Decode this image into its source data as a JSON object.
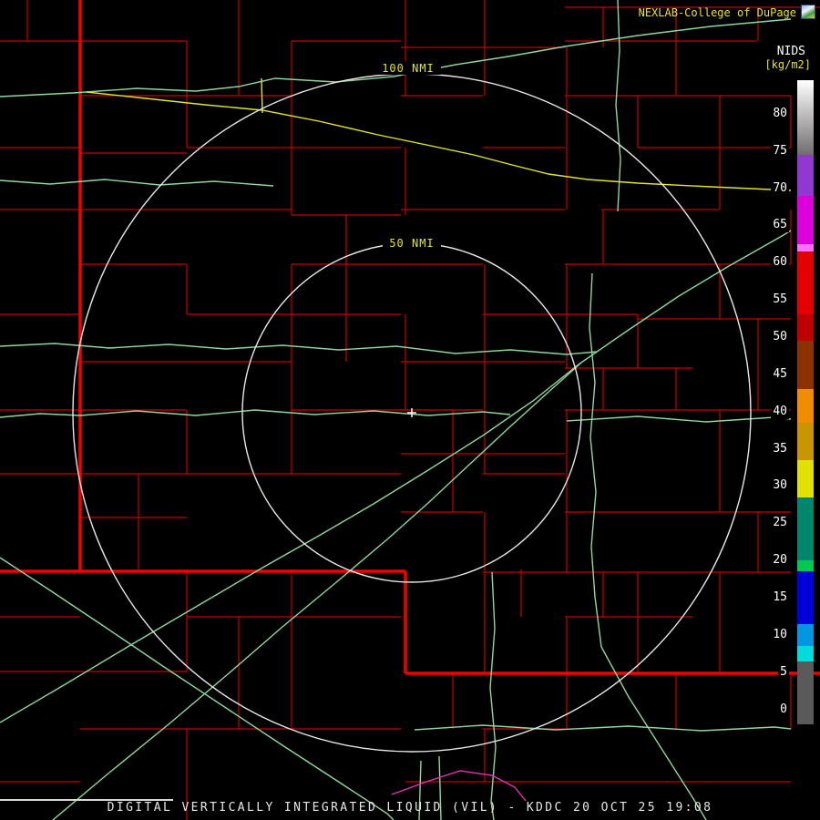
{
  "attribution": {
    "text": "NEXLAB-College of DuPage"
  },
  "colorbar": {
    "title": "NIDS",
    "unit": "[kg/m2]",
    "ticks": [
      80,
      75,
      70,
      65,
      60,
      55,
      50,
      45,
      40,
      35,
      30,
      25,
      20,
      15,
      10,
      5,
      0
    ],
    "scale_min": -2,
    "scale_max": 84.5,
    "segments": [
      {
        "from": 74.5,
        "to": 84.5,
        "gradient": true,
        "color_top": "#FFFFFF",
        "color_bottom": "#6E6E6E"
      },
      {
        "from": 69,
        "to": 74.5,
        "color": "#9137D2"
      },
      {
        "from": 62.5,
        "to": 69,
        "color": "#DC00DC"
      },
      {
        "from": 61.5,
        "to": 62.5,
        "color": "#FF6EFF"
      },
      {
        "from": 53,
        "to": 61.5,
        "color": "#E40000"
      },
      {
        "from": 49.5,
        "to": 53,
        "color": "#BE0000"
      },
      {
        "from": 43,
        "to": 49.5,
        "color": "#8C3200"
      },
      {
        "from": 38.5,
        "to": 43,
        "color": "#F08C00"
      },
      {
        "from": 33.5,
        "to": 38.5,
        "color": "#C89600"
      },
      {
        "from": 28.5,
        "to": 33.5,
        "color": "#E1E100"
      },
      {
        "from": 20,
        "to": 28.5,
        "color": "#00876B"
      },
      {
        "from": 18.5,
        "to": 20,
        "color": "#00C850"
      },
      {
        "from": 11.5,
        "to": 18.5,
        "color": "#0000DC"
      },
      {
        "from": 8.5,
        "to": 11.5,
        "color": "#0096E1"
      },
      {
        "from": 6.5,
        "to": 8.5,
        "color": "#00DCDC"
      },
      {
        "from": -2,
        "to": 6.5,
        "color": "#5A5A5A"
      }
    ]
  },
  "rings": [
    {
      "label": "100 NMI"
    },
    {
      "label": "50 NMI"
    }
  ],
  "caption": {
    "text": "DIGITAL VERTICALLY INTEGRATED LIQUID (VIL) - KDDC 20 OCT 25 19:08"
  },
  "theme": {
    "background": "#000000",
    "county": "#C80000",
    "state": "#F00000",
    "road_green": "#8FD7A0",
    "road_yellow": "#E3E332",
    "road_magenta": "#E832B4",
    "ring": "#E8E8E8"
  }
}
